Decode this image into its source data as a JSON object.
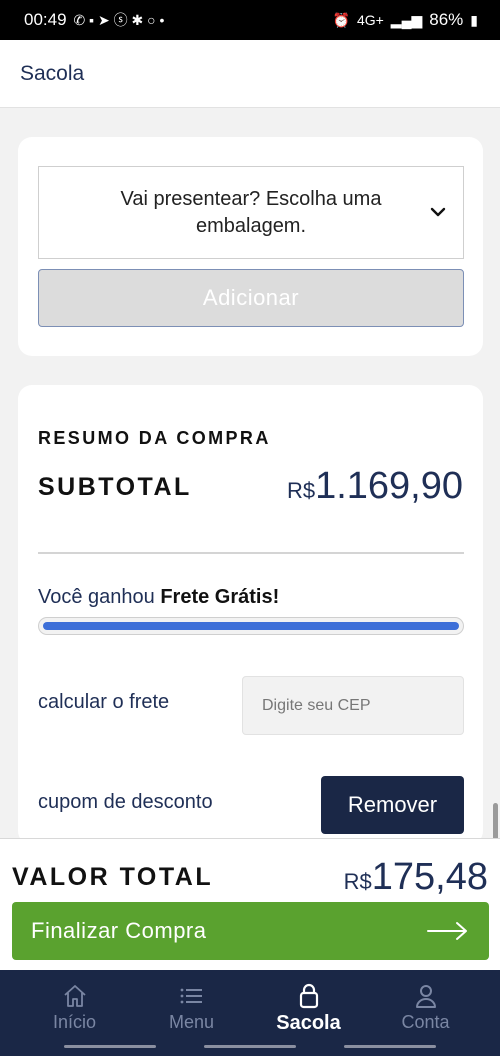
{
  "status_bar": {
    "time": "00:49",
    "battery": "86%",
    "network": "4G+"
  },
  "header": {
    "title": "Sacola"
  },
  "gift": {
    "select_text": "Vai presentear? Escolha uma embalagem.",
    "add_label": "Adicionar"
  },
  "summary": {
    "heading": "RESUMO DA COMPRA",
    "subtotal_label": "SUBTOTAL",
    "subtotal_currency": "R$",
    "subtotal_value": "1.169,90",
    "free_shipping_prefix": "Você ganhou",
    "free_shipping_bold": "Frete Grátis!",
    "free_shipping_progress": 1.0,
    "freight_label": "calcular o frete",
    "cep_placeholder": "Digite seu CEP",
    "coupon_label": "cupom de desconto",
    "remove_label": "Remover"
  },
  "total": {
    "label": "VALOR TOTAL",
    "currency": "R$",
    "value": "175,48",
    "checkout_label": "Finalizar Compra"
  },
  "nav": {
    "items": [
      {
        "label": "Início",
        "icon": "home-icon",
        "active": false
      },
      {
        "label": "Menu",
        "icon": "menu-icon",
        "active": false
      },
      {
        "label": "Sacola",
        "icon": "bag-icon",
        "active": true
      },
      {
        "label": "Conta",
        "icon": "user-icon",
        "active": false
      }
    ]
  },
  "colors": {
    "primary_dark": "#1a2746",
    "checkout_green": "#5aa22f",
    "progress_blue": "#3d6fd8"
  }
}
